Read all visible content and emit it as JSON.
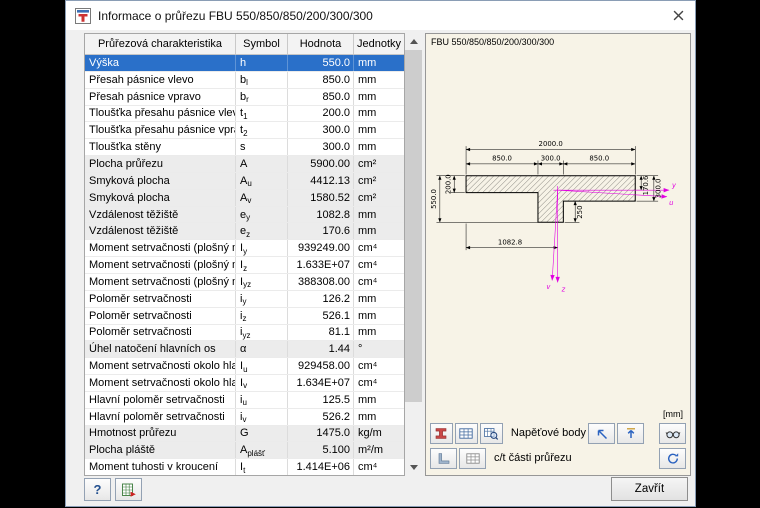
{
  "window": {
    "title": "Informace o průřezu FBU 550/850/850/200/300/300"
  },
  "table": {
    "headers": [
      "Průřezová charakteristika",
      "Symbol",
      "Hodnota",
      "Jednotky"
    ],
    "rows": [
      {
        "name": "Výška",
        "sym": "h",
        "sub": "",
        "value": "550.0",
        "unit": "mm",
        "state": "selected"
      },
      {
        "name": "Přesah pásnice vlevo",
        "sym": "b",
        "sub": "l",
        "value": "850.0",
        "unit": "mm"
      },
      {
        "name": "Přesah pásnice vpravo",
        "sym": "b",
        "sub": "r",
        "value": "850.0",
        "unit": "mm"
      },
      {
        "name": "Tloušťka přesahu pásnice vlevo",
        "sym": "t",
        "sub": "1",
        "value": "200.0",
        "unit": "mm"
      },
      {
        "name": "Tloušťka přesahu pásnice vpravo",
        "sym": "t",
        "sub": "2",
        "value": "300.0",
        "unit": "mm"
      },
      {
        "name": "Tloušťka stěny",
        "sym": "s",
        "sub": "",
        "value": "300.0",
        "unit": "mm"
      },
      {
        "name": "Plocha průřezu",
        "sym": "A",
        "sub": "",
        "value": "5900.00",
        "unit": "cm²",
        "shaded": true
      },
      {
        "name": "Smyková plocha",
        "sym": "A",
        "sub": "u",
        "value": "4412.13",
        "unit": "cm²",
        "shaded": true
      },
      {
        "name": "Smyková plocha",
        "sym": "A",
        "sub": "v",
        "value": "1580.52",
        "unit": "cm²",
        "shaded": true
      },
      {
        "name": "Vzdálenost těžiště",
        "sym": "e",
        "sub": "y",
        "value": "1082.8",
        "unit": "mm",
        "shaded": true
      },
      {
        "name": "Vzdálenost těžiště",
        "sym": "e",
        "sub": "z",
        "value": "170.6",
        "unit": "mm",
        "shaded": true
      },
      {
        "name": "Moment setrvačnosti (plošný moment",
        "sym": "I",
        "sub": "y",
        "value": "939249.00",
        "unit": "cm⁴"
      },
      {
        "name": "Moment setrvačnosti (plošný moment",
        "sym": "I",
        "sub": "z",
        "value": "1.633E+07",
        "unit": "cm⁴"
      },
      {
        "name": "Moment setrvačnosti (plošný moment",
        "sym": "I",
        "sub": "yz",
        "value": "388308.00",
        "unit": "cm⁴"
      },
      {
        "name": "Poloměr setrvačnosti",
        "sym": "i",
        "sub": "y",
        "value": "126.2",
        "unit": "mm"
      },
      {
        "name": "Poloměr setrvačnosti",
        "sym": "i",
        "sub": "z",
        "value": "526.1",
        "unit": "mm"
      },
      {
        "name": "Poloměr setrvačnosti",
        "sym": "i",
        "sub": "yz",
        "value": "81.1",
        "unit": "mm"
      },
      {
        "name": "Úhel natočení hlavních os",
        "sym": "α",
        "sub": "",
        "value": "1.44",
        "unit": "°",
        "shaded": true
      },
      {
        "name": "Moment setrvačnosti okolo hlavní osy",
        "sym": "I",
        "sub": "u",
        "value": "929458.00",
        "unit": "cm⁴"
      },
      {
        "name": "Moment setrvačnosti okolo hlavní osy",
        "sym": "I",
        "sub": "v",
        "value": "1.634E+07",
        "unit": "cm⁴"
      },
      {
        "name": "Hlavní poloměr setrvačnosti",
        "sym": "i",
        "sub": "u",
        "value": "125.5",
        "unit": "mm"
      },
      {
        "name": "Hlavní poloměr setrvačnosti",
        "sym": "i",
        "sub": "v",
        "value": "526.2",
        "unit": "mm"
      },
      {
        "name": "Hmotnost průřezu",
        "sym": "G",
        "sub": "",
        "value": "1475.0",
        "unit": "kg/m",
        "shaded": true
      },
      {
        "name": "Plocha pláště",
        "sym": "A",
        "sub": "plášť",
        "value": "5.100",
        "unit": "m²/m",
        "shaded": true
      },
      {
        "name": "Moment tuhosti v kroucení",
        "sym": "I",
        "sub": "t",
        "value": "1.414E+06",
        "unit": "cm⁴"
      }
    ]
  },
  "panel": {
    "caption": "FBU 550/850/850/200/300/300",
    "units_label": "[mm]",
    "dims": {
      "total_width": "2000.0",
      "left_flange": "850.0",
      "web": "300.0",
      "right_flange": "850.0",
      "left_thickness": "200.0",
      "right_thickness": "300.0",
      "height": "550.0",
      "web_below": "250",
      "ez": "170.6",
      "ey": "1082.8"
    },
    "axes": {
      "y": "y",
      "u": "u",
      "z": "z",
      "v": "v"
    },
    "toolbar": {
      "stress_points_label": "Napěťové body",
      "ct_parts_label": "c/t části průřezu"
    }
  },
  "footer": {
    "help_glyph": "?",
    "close_label": "Zavřít"
  },
  "colors": {
    "selected_row": "#2a70c9",
    "panel_background": "#f7f3e7",
    "axis_magenta": "#e100e1"
  }
}
